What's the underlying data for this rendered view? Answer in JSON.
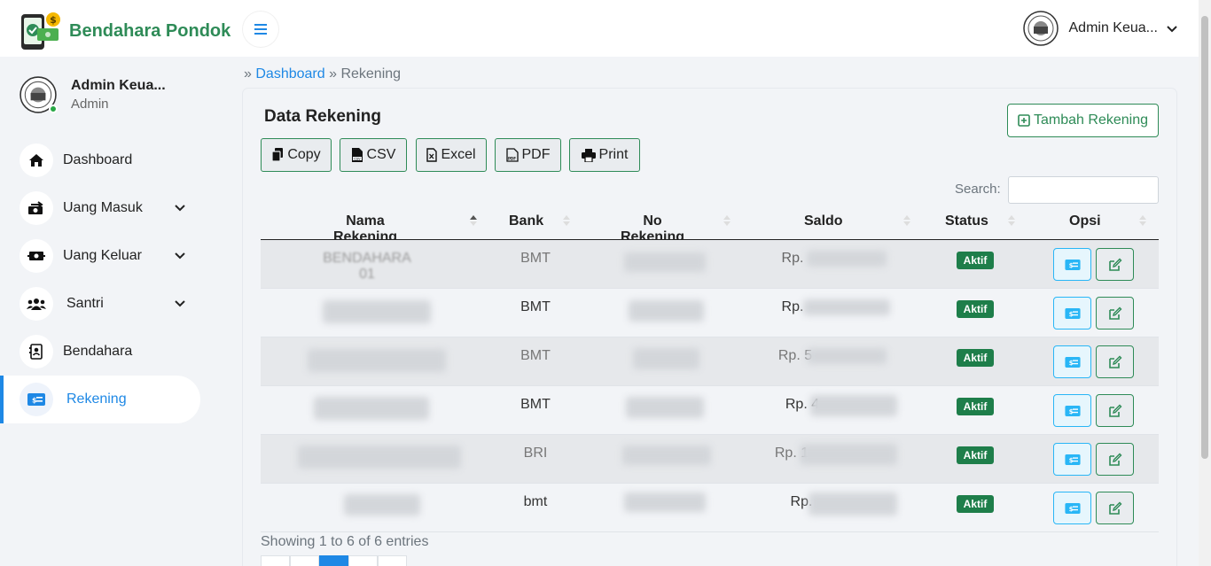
{
  "app": {
    "title": "Bendahara Pondok",
    "brand_color": "#2e8b57",
    "accent": "#1e88e5"
  },
  "topbar": {
    "user_name": "Admin Keua..."
  },
  "sidebar": {
    "profile": {
      "name": "Admin Keua...",
      "role": "Admin"
    },
    "items": [
      {
        "label": "Dashboard",
        "icon": "home-icon",
        "has_dropdown": false
      },
      {
        "label": "Uang Masuk",
        "icon": "money-in-icon",
        "has_dropdown": true
      },
      {
        "label": "Uang Keluar",
        "icon": "money-out-icon",
        "has_dropdown": true
      },
      {
        "label": "Santri",
        "icon": "users-icon",
        "has_dropdown": true
      },
      {
        "label": "Bendahara",
        "icon": "contact-card-icon",
        "has_dropdown": false
      },
      {
        "label": "Rekening",
        "icon": "money-check-icon",
        "has_dropdown": false,
        "active": true
      }
    ]
  },
  "breadcrumb": {
    "prefix": "»",
    "home": "Dashboard",
    "separator": "»",
    "current": "Rekening"
  },
  "card": {
    "title": "Data Rekening",
    "add_button": "Tambah Rekening",
    "export_buttons": [
      "Copy",
      "CSV",
      "Excel",
      "PDF",
      "Print"
    ],
    "search_label": "Search:"
  },
  "table": {
    "columns": [
      "Nama Rekening",
      "Bank",
      "No Rekening",
      "Saldo",
      "Status",
      "Opsi"
    ],
    "rows": [
      {
        "name": "BENDAHARA 01",
        "bank": "BMT",
        "saldo_prefix": "Rp.",
        "status": "Aktif"
      },
      {
        "name": "",
        "bank": "BMT",
        "saldo_prefix": "Rp.",
        "status": "Aktif"
      },
      {
        "name": "",
        "bank": "BMT",
        "saldo_prefix": "Rp. 5",
        "status": "Aktif"
      },
      {
        "name": "",
        "bank": "BMT",
        "saldo_prefix": "Rp. 4",
        "status": "Aktif"
      },
      {
        "name": "",
        "bank": "BRI",
        "saldo_prefix": "Rp. 1",
        "status": "Aktif"
      },
      {
        "name": "",
        "bank": "bmt",
        "saldo_prefix": "Rp.",
        "status": "Aktif"
      }
    ]
  },
  "footer": {
    "showing": "Showing 1 to 6 of 6 entries"
  }
}
